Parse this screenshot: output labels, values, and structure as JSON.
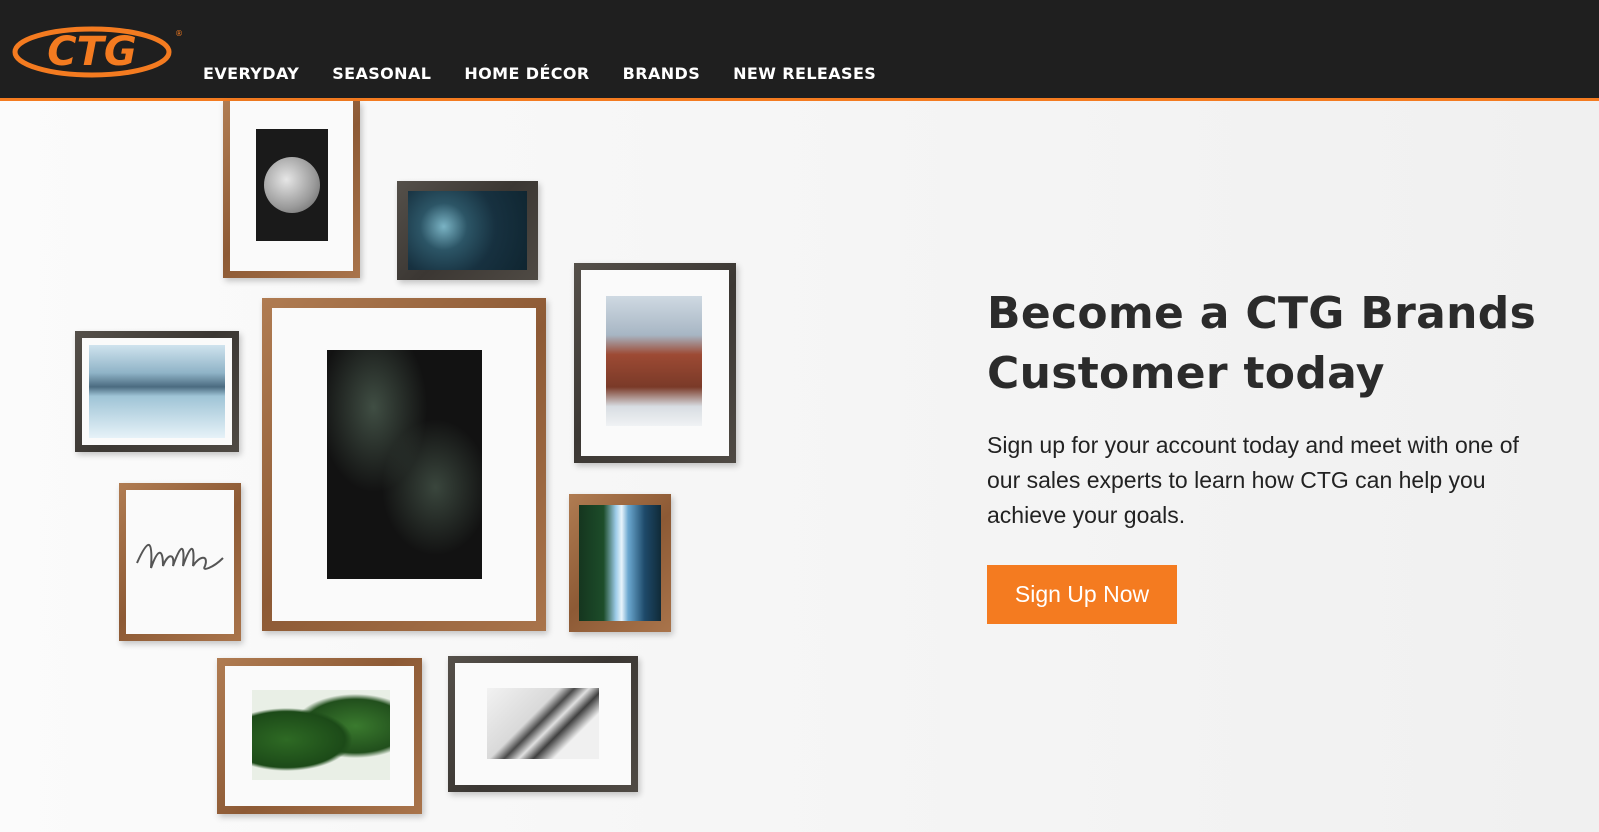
{
  "header": {
    "logo_text": "CTG",
    "nav": [
      {
        "label": "EVERYDAY"
      },
      {
        "label": "SEASONAL"
      },
      {
        "label": "HOME DÉCOR"
      },
      {
        "label": "BRANDS"
      },
      {
        "label": "NEW RELEASES"
      }
    ]
  },
  "hero": {
    "headline": "Become a CTG Brands Customer today",
    "body": "Sign up for your account today and meet with one of our sales experts to learn how CTG can help you achieve your goals.",
    "cta_label": "Sign Up Now"
  },
  "colors": {
    "brand_orange": "#f47b20",
    "header_bg": "#1f1f1f"
  },
  "gallery_art": [
    "moon",
    "succulent",
    "mountain-lake",
    "monstera-leaves-dark",
    "city-buildings",
    "hello-script",
    "waterfall",
    "monstera-plant",
    "palm-leaves"
  ]
}
